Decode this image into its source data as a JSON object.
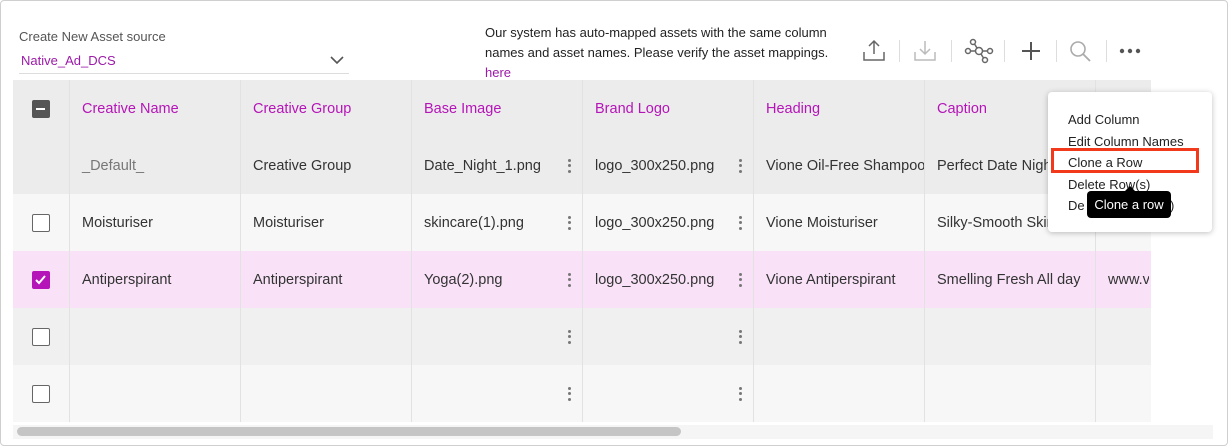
{
  "header": {
    "source_label": "Create New Asset source",
    "source_value": "Native_Ad_DCS",
    "notice_text": "Our system has auto-mapped assets with the same column names and asset names. Please verify the asset mappings.",
    "notice_link": "here"
  },
  "toolbar": {
    "icons": [
      "upload-icon",
      "download-icon",
      "network-icon",
      "plus-icon",
      "search-icon",
      "more-icon"
    ]
  },
  "table": {
    "columns": [
      "Creative Name",
      "Creative Group",
      "Base Image",
      "Brand Logo",
      "Heading",
      "Caption"
    ],
    "rows": [
      {
        "checkbox": "none",
        "cells": [
          "_Default_",
          "Creative Group",
          "Date_Night_1.png",
          "logo_300x250.png",
          "Vione Oil-Free Shampoo",
          "Perfect Date Night"
        ],
        "extra": ""
      },
      {
        "checkbox": "unchecked",
        "cells": [
          "Moisturiser",
          "Moisturiser",
          "skincare(1).png",
          "logo_300x250.png",
          "Vione Moisturiser",
          "Silky-Smooth Skin"
        ],
        "extra": ""
      },
      {
        "checkbox": "checked",
        "cells": [
          "Antiperspirant",
          "Antiperspirant",
          "Yoga(2).png",
          "logo_300x250.png",
          "Vione Antiperspirant",
          "Smelling Fresh All day"
        ],
        "extra": "www.vi"
      },
      {
        "checkbox": "unchecked",
        "cells": [
          "",
          "",
          "",
          "",
          "",
          ""
        ],
        "extra": ""
      },
      {
        "checkbox": "unchecked",
        "cells": [
          "",
          "",
          "",
          "",
          "",
          ""
        ],
        "extra": ""
      }
    ]
  },
  "menu": {
    "items": [
      "Add Column",
      "Edit Column Names",
      "Clone a Row",
      "Delete Row(s)",
      "De"
    ],
    "tooltip": "Clone a row",
    "obscured_suffix": ")"
  },
  "colors": {
    "accent": "#b515b8",
    "selected_row": "#f9e2f8",
    "highlight": "#f2391b"
  }
}
